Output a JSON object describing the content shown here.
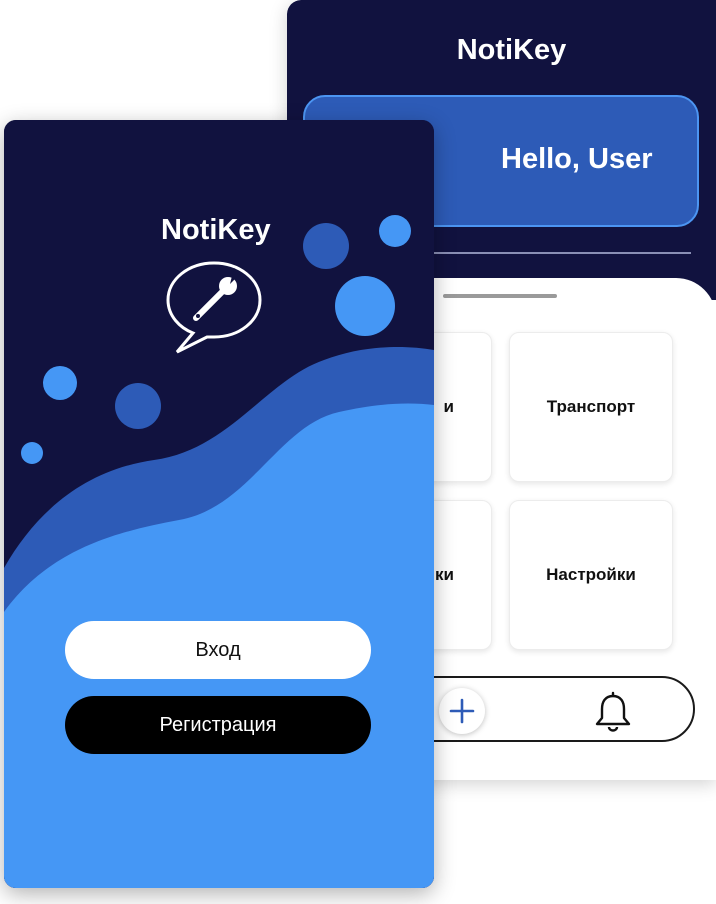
{
  "home": {
    "title": "NotiKey",
    "greeting": "Hello, User",
    "tiles": [
      "и",
      "Транспорт",
      "ки",
      "Настройки"
    ],
    "nav": {
      "add_icon": "plus-icon",
      "bell_icon": "bell-icon"
    }
  },
  "login": {
    "title": "NotiKey",
    "logo_icon": "chat-wrench-icon",
    "login_label": "Вход",
    "register_label": "Регистрация"
  },
  "colors": {
    "navy": "#11123f",
    "royal_blue": "#2d5bb7",
    "light_blue": "#4597f5",
    "accent_border": "#4c95f2",
    "black": "#000000",
    "white": "#ffffff"
  }
}
